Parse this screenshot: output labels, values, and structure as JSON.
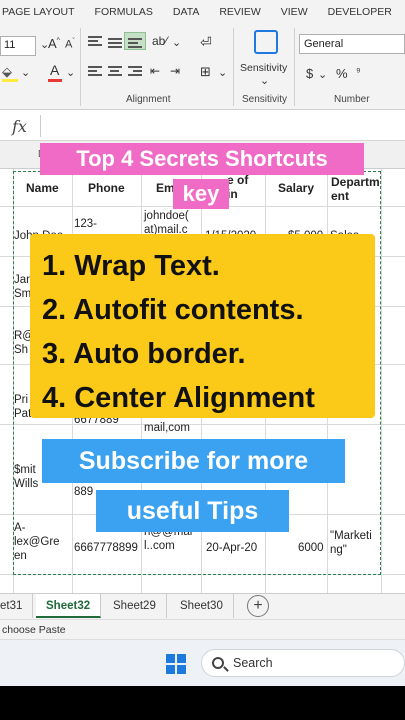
{
  "ribbon": {
    "tabs": [
      "PAGE LAYOUT",
      "FORMULAS",
      "DATA",
      "REVIEW",
      "VIEW",
      "DEVELOPER"
    ],
    "font_size": "11",
    "number_format": "General",
    "sensitivity_label": "Sensitivity",
    "groups": {
      "alignment": "Alignment",
      "sensitivity": "Sensitivity",
      "number": "Number"
    },
    "currency": "$",
    "percent": "%"
  },
  "formula_bar": {
    "fx": "fx"
  },
  "column_hint": "D",
  "table": {
    "headers": [
      "Name",
      "Phone",
      "Em",
      "e of\nin",
      "Salary",
      "Departm\nent"
    ],
    "rows": [
      {
        "c1": "John Doe",
        "c2": "123-",
        "c3": "johndoe(\nat)mail.c",
        "c4": "1/15/2020",
        "c5": "$5,000",
        "c6": "Sales"
      },
      {
        "c1": "Jar\nSm",
        "c2": "",
        "c3": "",
        "c4": "",
        "c5": "",
        "c6": ""
      },
      {
        "c1": "R@\nSh",
        "c2": "",
        "c3": "",
        "c4": "",
        "c5": "",
        "c6": ""
      },
      {
        "c1": "Pri\nPatel",
        "c2": "6677889",
        "c3": "mail,com",
        "c4": "",
        "c5": "",
        "c6": ""
      },
      {
        "c1": "$mit\nWills",
        "c2": "889",
        "c3": "",
        "c4": "",
        "c5": "",
        "c6": ""
      },
      {
        "c1": "A-\nlex@Gre\nen",
        "c2": "6667778899",
        "c3": "n@@mai\nl..com",
        "c4": "20-Apr-20",
        "c5": "6000",
        "c6": "\"Marketi\nng\""
      }
    ]
  },
  "overlays": {
    "title_line1": "Top 4 Secrets Shortcuts",
    "title_line2": "key",
    "tips": [
      "1. Wrap Text.",
      "2. Autofit contents.",
      "3. Auto border.",
      "4. Center Alignment"
    ],
    "subscribe_line1": "Subscribe for more",
    "subscribe_line2": "useful Tips"
  },
  "sheets": {
    "tabs": [
      "et31",
      "Sheet32",
      "Sheet29",
      "Sheet30"
    ],
    "active": "Sheet32",
    "add": "+"
  },
  "status_text": "choose Paste",
  "taskbar": {
    "search_placeholder": "Search"
  },
  "colors": {
    "accent_green": "#1f6b3a",
    "pink": "#f06bc5",
    "yellow": "#fbc918",
    "blue": "#3aa2f0"
  }
}
